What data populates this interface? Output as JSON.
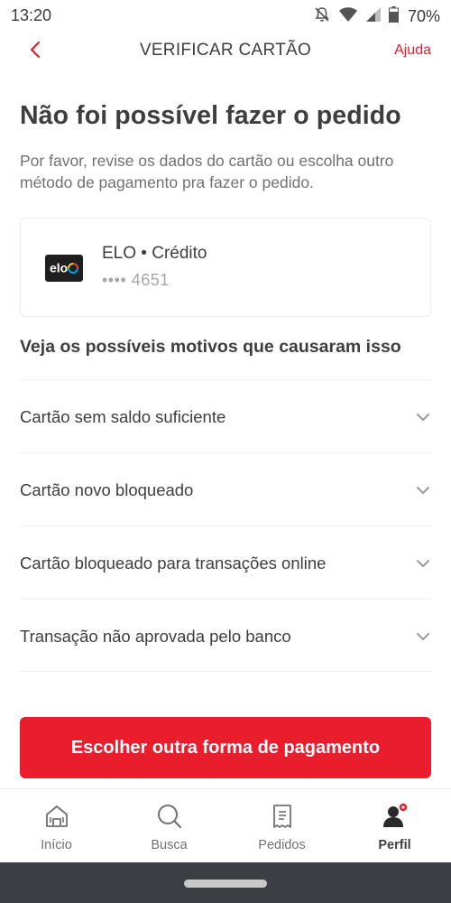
{
  "status_bar": {
    "time": "13:20",
    "battery": "70%"
  },
  "header": {
    "title": "VERIFICAR CARTÃO",
    "help_label": "Ajuda",
    "back_icon": "chevron-left-icon"
  },
  "main": {
    "heading": "Não foi possível fazer o pedido",
    "description": "Por favor, revise os dados do cartão ou escolha outro método de pagamento pra fazer o pedido.",
    "card": {
      "brand_logo_text": "elo",
      "name": "ELO • Crédito",
      "number": "•••• 4651"
    },
    "reasons_heading": "Veja os possíveis motivos que causaram isso",
    "reasons": [
      {
        "label": "Cartão sem saldo suficiente"
      },
      {
        "label": "Cartão novo bloqueado"
      },
      {
        "label": "Cartão bloqueado para transações online"
      },
      {
        "label": "Transação não aprovada pelo banco"
      }
    ],
    "primary_button": "Escolher outra forma de pagamento"
  },
  "bottom_nav": {
    "items": [
      {
        "label": "Início",
        "icon": "home-icon",
        "active": false
      },
      {
        "label": "Busca",
        "icon": "search-icon",
        "active": false
      },
      {
        "label": "Pedidos",
        "icon": "receipt-icon",
        "active": false
      },
      {
        "label": "Perfil",
        "icon": "profile-icon",
        "active": true
      }
    ]
  },
  "colors": {
    "brand_red": "#ea1d2c",
    "text_primary": "#3e3e3e",
    "text_secondary": "#717171",
    "text_muted": "#a6a6a6"
  }
}
